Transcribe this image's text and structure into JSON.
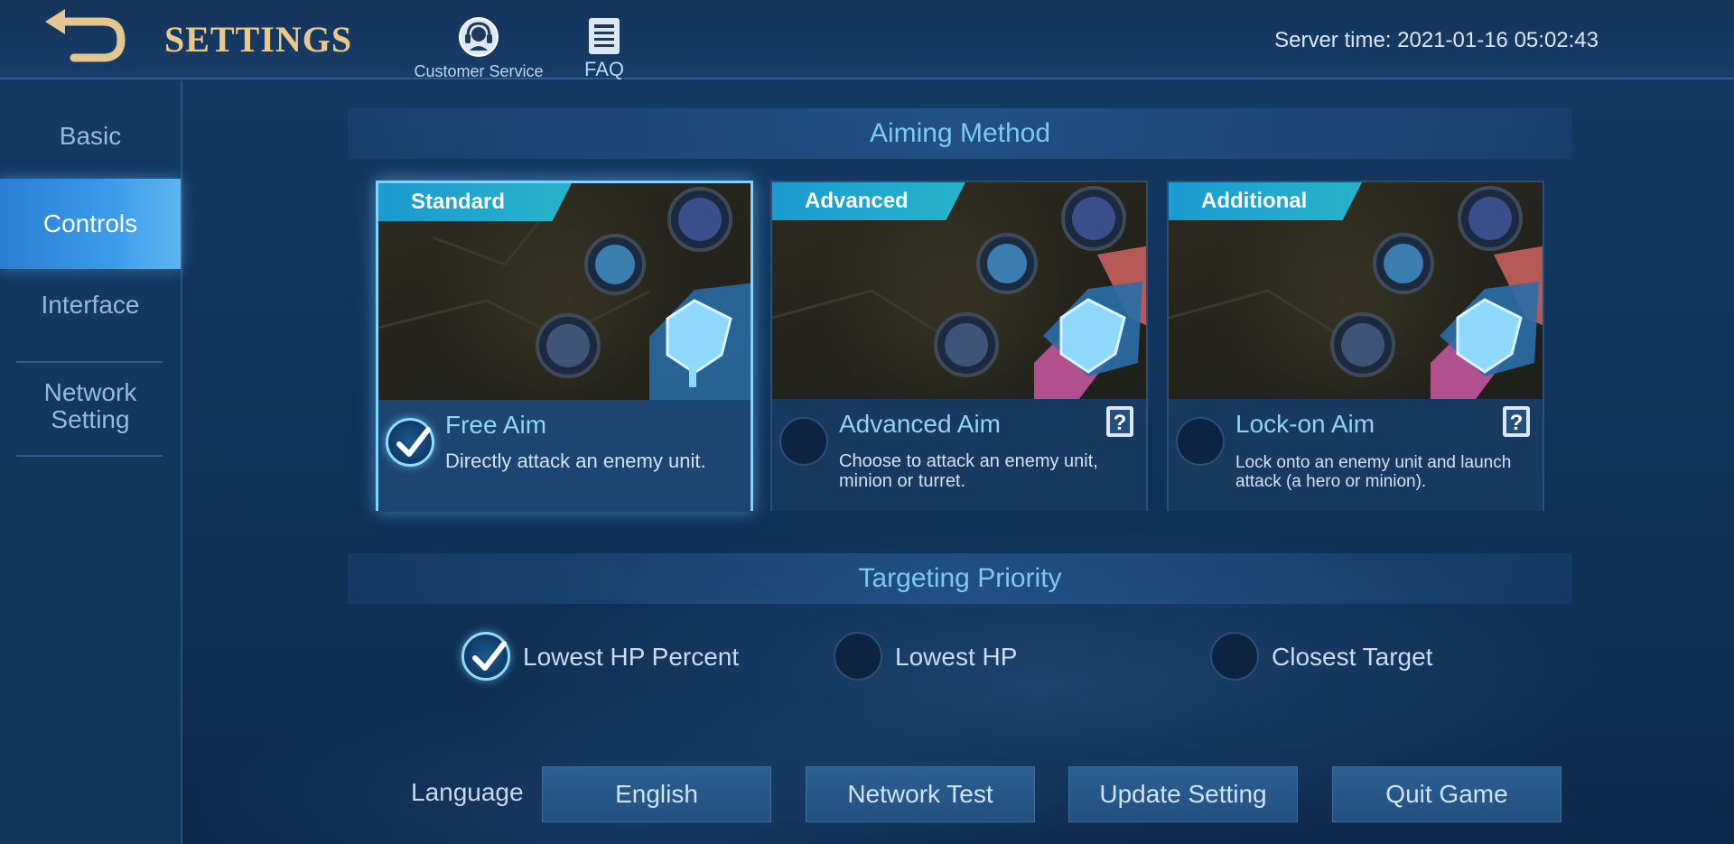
{
  "header": {
    "title": "SETTINGS",
    "customer_service": "Customer Service",
    "faq": "FAQ",
    "server_time": "Server time: 2021-01-16 05:02:43"
  },
  "sidebar": {
    "items": [
      {
        "label": "Basic",
        "active": false
      },
      {
        "label": "Controls",
        "active": true
      },
      {
        "label": "Interface",
        "active": false
      },
      {
        "label": "Network\nSetting",
        "active": false
      }
    ]
  },
  "aiming": {
    "section_title": "Aiming Method",
    "cards": [
      {
        "tag": "Standard",
        "title": "Free Aim",
        "description": "Directly attack an enemy unit.",
        "selected": true
      },
      {
        "tag": "Advanced",
        "title": "Advanced Aim",
        "description": "Choose to attack an enemy unit, minion or turret.",
        "selected": false
      },
      {
        "tag": "Additional",
        "title": "Lock-on Aim",
        "description": "Lock onto an enemy unit and launch attack (a hero or minion).",
        "selected": false
      }
    ]
  },
  "targeting": {
    "section_title": "Targeting Priority",
    "options": [
      {
        "label": "Lowest HP Percent",
        "selected": true
      },
      {
        "label": "Lowest HP",
        "selected": false
      },
      {
        "label": "Closest Target",
        "selected": false
      }
    ]
  },
  "bottom": {
    "language_label": "Language",
    "buttons": [
      "English",
      "Network Test",
      "Update Setting",
      "Quit Game"
    ]
  },
  "colors": {
    "accent": "#7fd2ff",
    "title_gold": "#e9c98a",
    "section_text": "#7ec8f2",
    "tag_bg": "#1a9bd1"
  },
  "icons": [
    "back-arrow-icon",
    "headset-icon",
    "faq-book-icon",
    "checkmark-icon",
    "help-question-icon"
  ]
}
